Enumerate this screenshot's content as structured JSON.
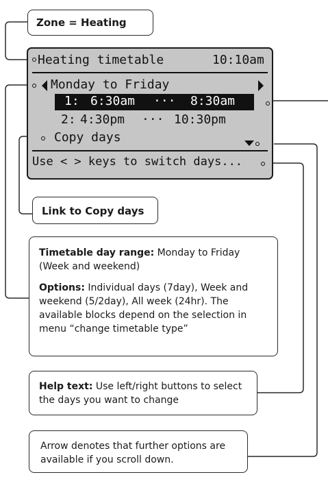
{
  "zone_label": "Zone = Heating",
  "screen": {
    "title": "Heating timetable",
    "time": "10:10am",
    "day_range": "Monday to Friday",
    "rows": [
      {
        "num": "1:",
        "start": "6:30am",
        "sep": "···",
        "end": "8:30am",
        "selected": true
      },
      {
        "num": "2:",
        "start": "4:30pm",
        "sep": "···",
        "end": "10:30pm",
        "selected": false
      }
    ],
    "copy_days": "Copy days",
    "help": "Use < > keys to switch days..."
  },
  "link_label": "Link to Copy days",
  "range_box": {
    "heading": "Timetable day range:",
    "heading_text": " Monday to Friday (Week and weekend)",
    "options_heading": "Options:",
    "options_text": " Individual days (7day), Week and weekend (5/2day), All week (24hr). The available blocks depend on the selection in menu “change timetable type”"
  },
  "help_box": {
    "heading": "Help text:",
    "text": " Use left/right buttons to select the days you want to change"
  },
  "arrow_box": {
    "text": "Arrow denotes that further options are available if you scroll down."
  }
}
